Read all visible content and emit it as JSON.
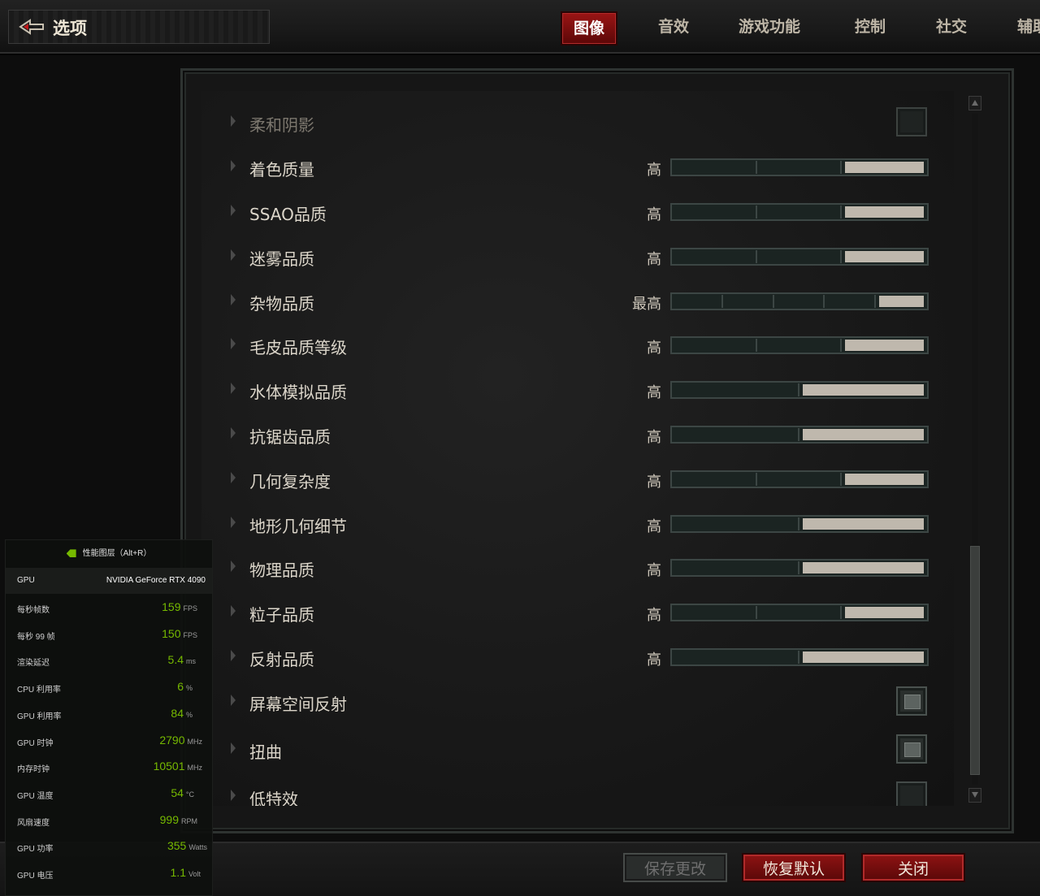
{
  "header": {
    "title": "选项",
    "tabs": [
      {
        "label": "图像",
        "active": true
      },
      {
        "label": "音效",
        "active": false
      },
      {
        "label": "游戏功能",
        "active": false
      },
      {
        "label": "控制",
        "active": false
      },
      {
        "label": "社交",
        "active": false
      },
      {
        "label": "辅助",
        "active": false
      }
    ]
  },
  "settings": [
    {
      "label": "柔和阴影",
      "type": "checkbox",
      "checked": false,
      "dim": true
    },
    {
      "label": "着色质量",
      "value": "高",
      "type": "slider",
      "steps": 3,
      "level": 3
    },
    {
      "label": "SSAO品质",
      "value": "高",
      "type": "slider",
      "steps": 3,
      "level": 3
    },
    {
      "label": "迷雾品质",
      "value": "高",
      "type": "slider",
      "steps": 3,
      "level": 3
    },
    {
      "label": "杂物品质",
      "value": "最高",
      "type": "slider",
      "steps": 5,
      "level": 5
    },
    {
      "label": "毛皮品质等级",
      "value": "高",
      "type": "slider",
      "steps": 3,
      "level": 3
    },
    {
      "label": "水体模拟品质",
      "value": "高",
      "type": "slider",
      "steps": 2,
      "level": 2
    },
    {
      "label": "抗锯齿品质",
      "value": "高",
      "type": "slider",
      "steps": 2,
      "level": 2
    },
    {
      "label": "几何复杂度",
      "value": "高",
      "type": "slider",
      "steps": 3,
      "level": 3
    },
    {
      "label": "地形几何细节",
      "value": "高",
      "type": "slider",
      "steps": 2,
      "level": 2
    },
    {
      "label": "物理品质",
      "value": "高",
      "type": "slider",
      "steps": 2,
      "level": 2
    },
    {
      "label": "粒子品质",
      "value": "高",
      "type": "slider",
      "steps": 3,
      "level": 3
    },
    {
      "label": "反射品质",
      "value": "高",
      "type": "slider",
      "steps": 2,
      "level": 2
    },
    {
      "label": "屏幕空间反射",
      "type": "checkbox",
      "checked": true
    },
    {
      "label": "扭曲",
      "type": "checkbox",
      "checked": true
    },
    {
      "label": "低特效",
      "type": "checkbox",
      "checked": false
    }
  ],
  "buttons": {
    "save": "保存更改",
    "reset": "恢复默认",
    "close": "关闭"
  },
  "overlay": {
    "header": "性能图层（Alt+R）",
    "gpu_label": "GPU",
    "gpu_name": "NVIDIA GeForce RTX 4090",
    "metrics": [
      {
        "label": "每秒帧数",
        "value": "159",
        "unit": "FPS"
      },
      {
        "label": "每秒 99 帧",
        "value": "150",
        "unit": "FPS"
      },
      {
        "label": "渲染延迟",
        "value": "5.4",
        "unit": "ms"
      },
      {
        "label": "CPU 利用率",
        "value": "6",
        "unit": "%"
      },
      {
        "label": "GPU 利用率",
        "value": "84",
        "unit": "%"
      },
      {
        "label": "GPU 时钟",
        "value": "2790",
        "unit": "MHz"
      },
      {
        "label": "内存时钟",
        "value": "10501",
        "unit": "MHz"
      },
      {
        "label": "GPU 温度",
        "value": "54",
        "unit": "°C"
      },
      {
        "label": "风扇速度",
        "value": "999",
        "unit": "RPM"
      },
      {
        "label": "GPU 功率",
        "value": "355",
        "unit": "Watts"
      },
      {
        "label": "GPU 电压",
        "value": "1.1",
        "unit": "Volt"
      }
    ]
  },
  "colors": {
    "accent_red": "#8e1313",
    "metric_green": "#76b900",
    "slider_fill": "#bfb8ad"
  }
}
